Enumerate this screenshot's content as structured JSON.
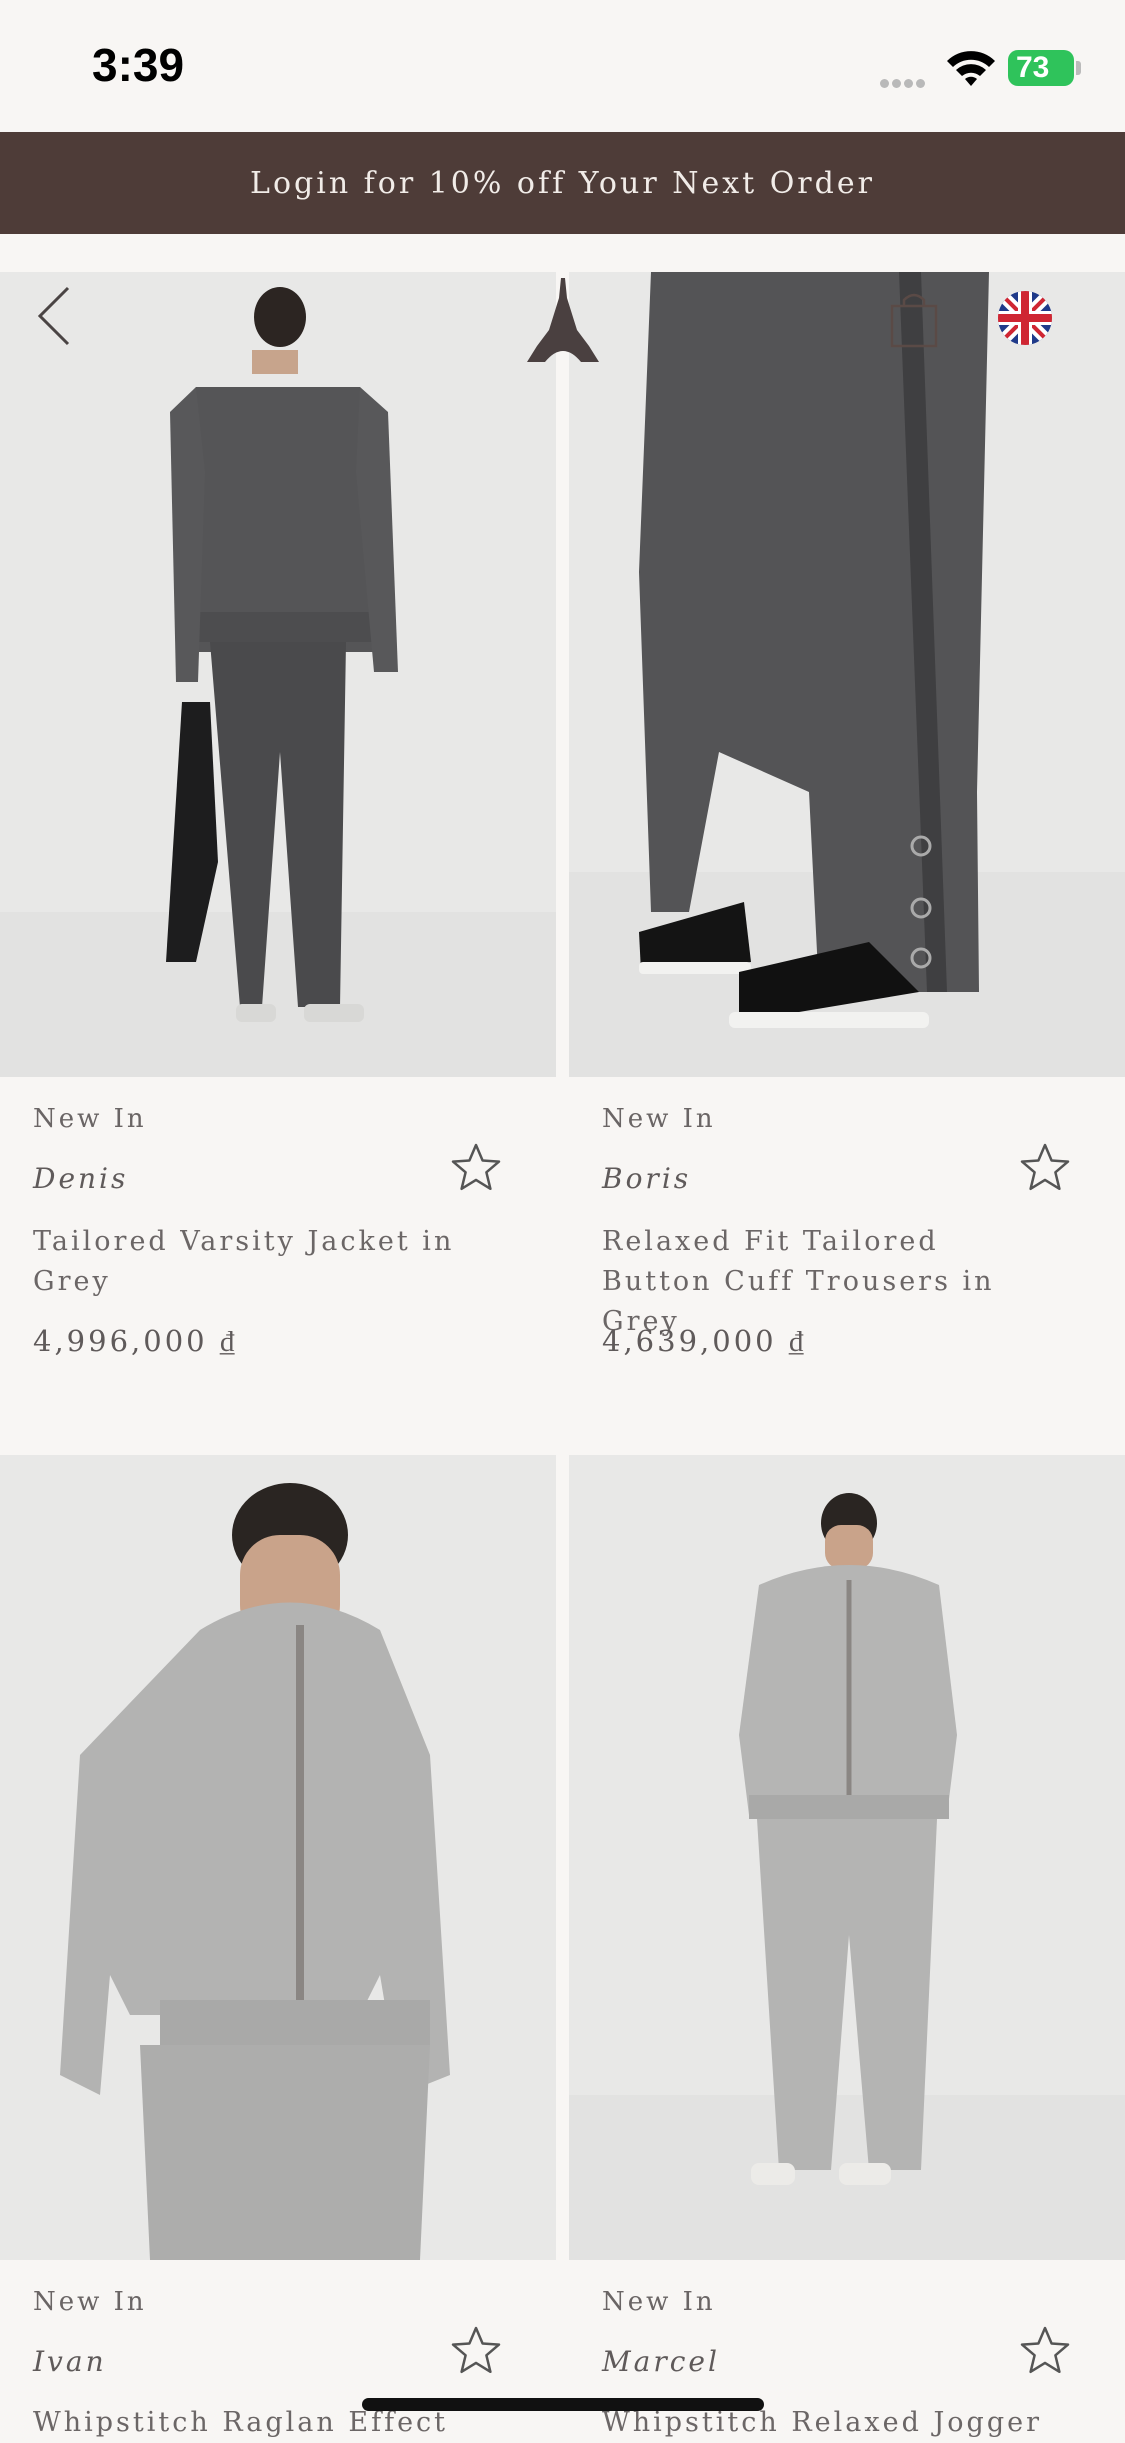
{
  "status_bar": {
    "time": "3:39",
    "battery": "73"
  },
  "promo_banner": {
    "text": "Login for 10% off Your Next Order"
  },
  "products": [
    {
      "tag": "New In",
      "brand": "Denis",
      "name": "Tailored Varsity Jacket in Grey",
      "price": "4,996,000 ₫"
    },
    {
      "tag": "New In",
      "brand": "Boris",
      "name": "Relaxed Fit Tailored Button Cuff Trousers in Grey",
      "price": "4,639,000 ₫"
    },
    {
      "tag": "New In",
      "brand": "Ivan",
      "name": "Whipstitch Raglan Effect",
      "price": ""
    },
    {
      "tag": "New In",
      "brand": "Marcel",
      "name": "Whipstitch Relaxed Jogger",
      "price": ""
    }
  ],
  "icons": {
    "back": "chevron-left-icon",
    "logo": "eiffel-tower-logo",
    "bag": "shopping-bag-icon",
    "language": "uk-flag-icon",
    "favorite": "star-outline-icon"
  },
  "colors": {
    "banner": "#4e3c38",
    "background": "#f8f6f4",
    "battery": "#2fc35b"
  }
}
